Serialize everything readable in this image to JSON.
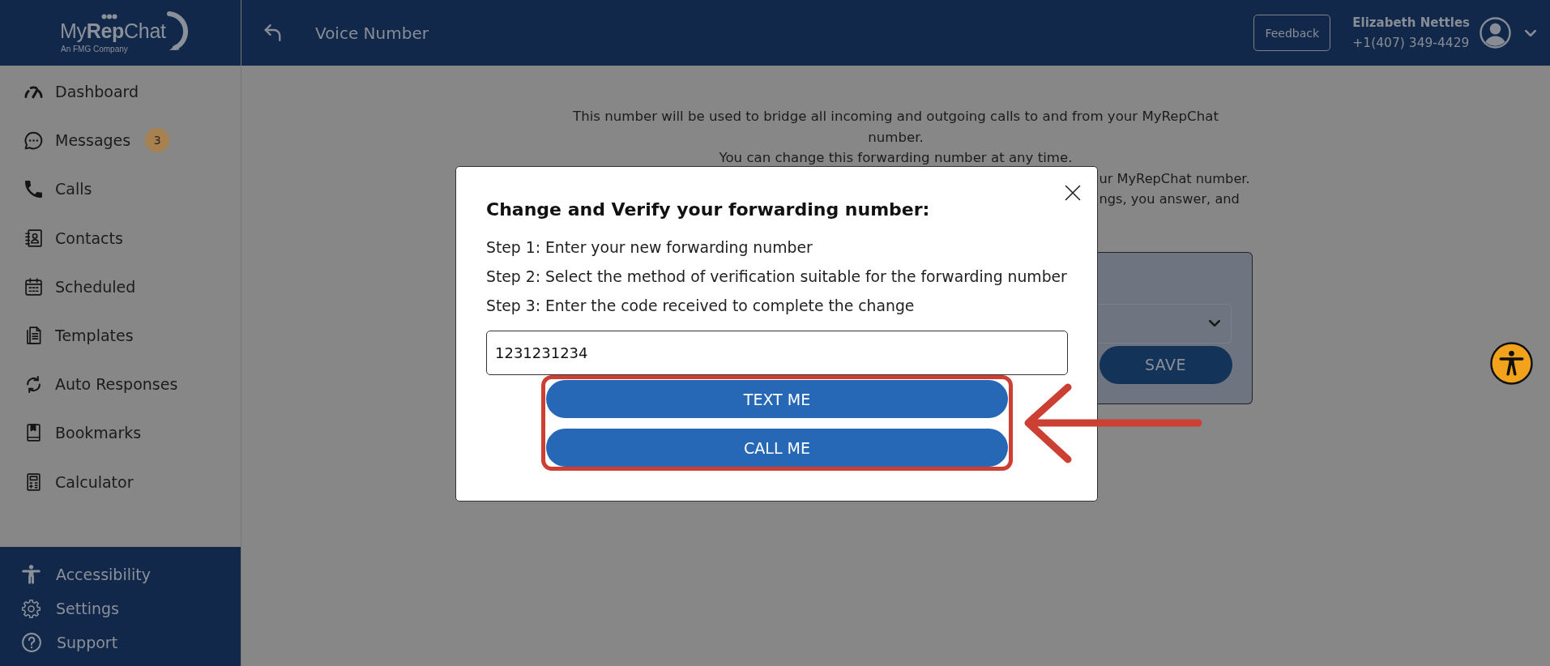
{
  "sidebar": {
    "logo": {
      "name": "My**Rep**Chat",
      "tagline": "An FMG Company"
    },
    "nav_items": [
      {
        "label": "Dashboard"
      },
      {
        "label": "Messages",
        "badge": "3"
      },
      {
        "label": "Calls"
      },
      {
        "label": "Contacts"
      },
      {
        "label": "Scheduled"
      },
      {
        "label": "Templates"
      },
      {
        "label": "Auto Responses"
      },
      {
        "label": "Bookmarks"
      },
      {
        "label": "Calculator"
      }
    ],
    "footer_items": [
      {
        "label": "Accessibility"
      },
      {
        "label": "Settings"
      },
      {
        "label": "Support"
      }
    ]
  },
  "header": {
    "title": "Voice Number",
    "feedback_button": "Feedback",
    "user": {
      "name": "Elizabeth Nettles",
      "phone": "+1(407) 349-4429"
    }
  },
  "page": {
    "description": [
      "This number will be used to bridge all incoming and outgoing calls to and from your MyRepChat number.",
      "You can change this forwarding number at any time."
    ],
    "partial_lines": [
      "ur MyRepChat number.",
      "ngs, you answer, and"
    ],
    "save_button": "SAVE"
  },
  "dialog": {
    "title": "Change and Verify your forwarding number:",
    "steps": [
      "Step 1: Enter your new forwarding number",
      "Step 2: Select the method of verification suitable for the forwarding number",
      "Step 3: Enter the code received to complete the change"
    ],
    "phone_field": {
      "value": "1231231234"
    },
    "buttons": [
      "TEXT ME",
      "CALL ME"
    ],
    "buttons_highlighted": true
  },
  "annotations": {
    "arrow": true
  }
}
